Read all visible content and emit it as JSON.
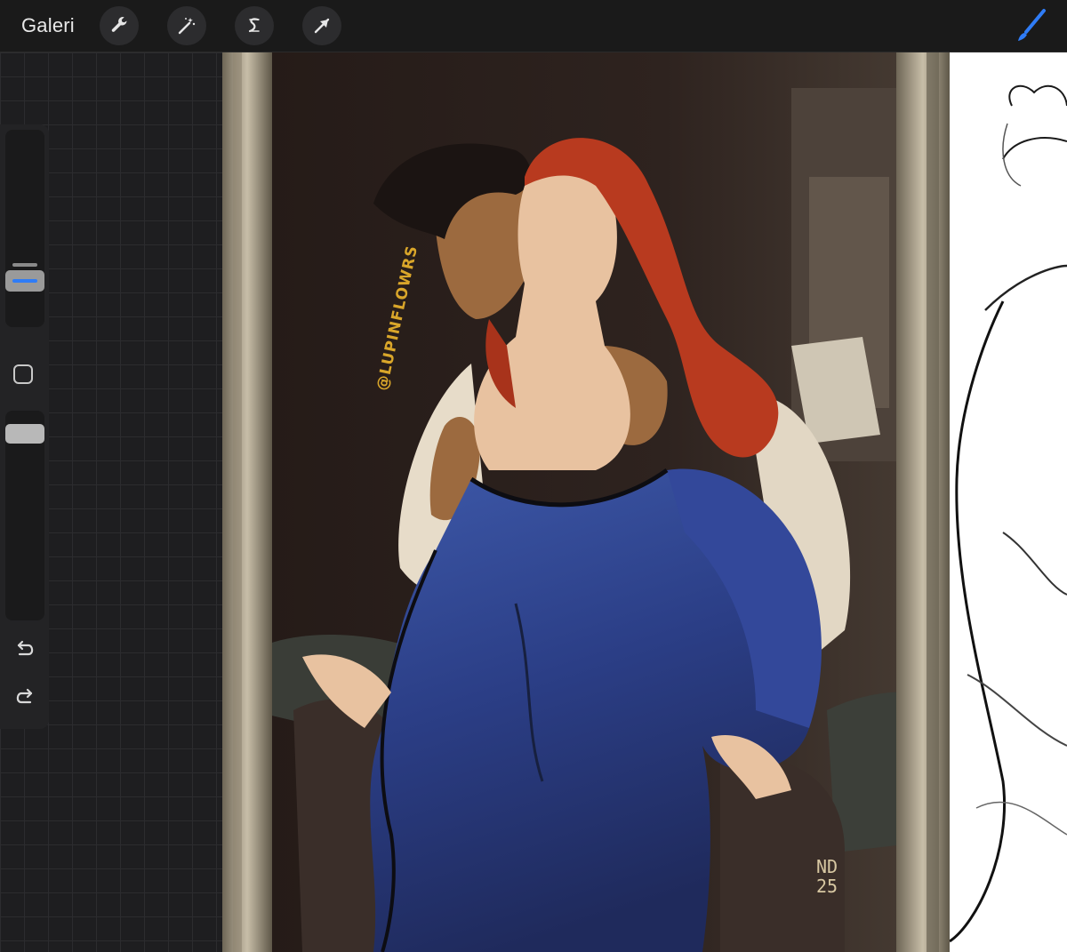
{
  "toolbar": {
    "gallery_label": "Galeri",
    "tools": [
      "wrench-icon",
      "magic-wand-icon",
      "selection-icon",
      "transform-arrow-icon"
    ],
    "active_tool": "brush-icon",
    "accent_color": "#2f7cf6"
  },
  "sidebar": {
    "brush_size": 0.28,
    "brush_opacity": 0.95,
    "controls": [
      "size-slider",
      "modify-button",
      "opacity-slider",
      "undo-icon",
      "redo-icon"
    ]
  },
  "canvas": {
    "watermark": "@LUPINFLOWRS",
    "signature_lines": [
      "ND",
      "25"
    ]
  }
}
